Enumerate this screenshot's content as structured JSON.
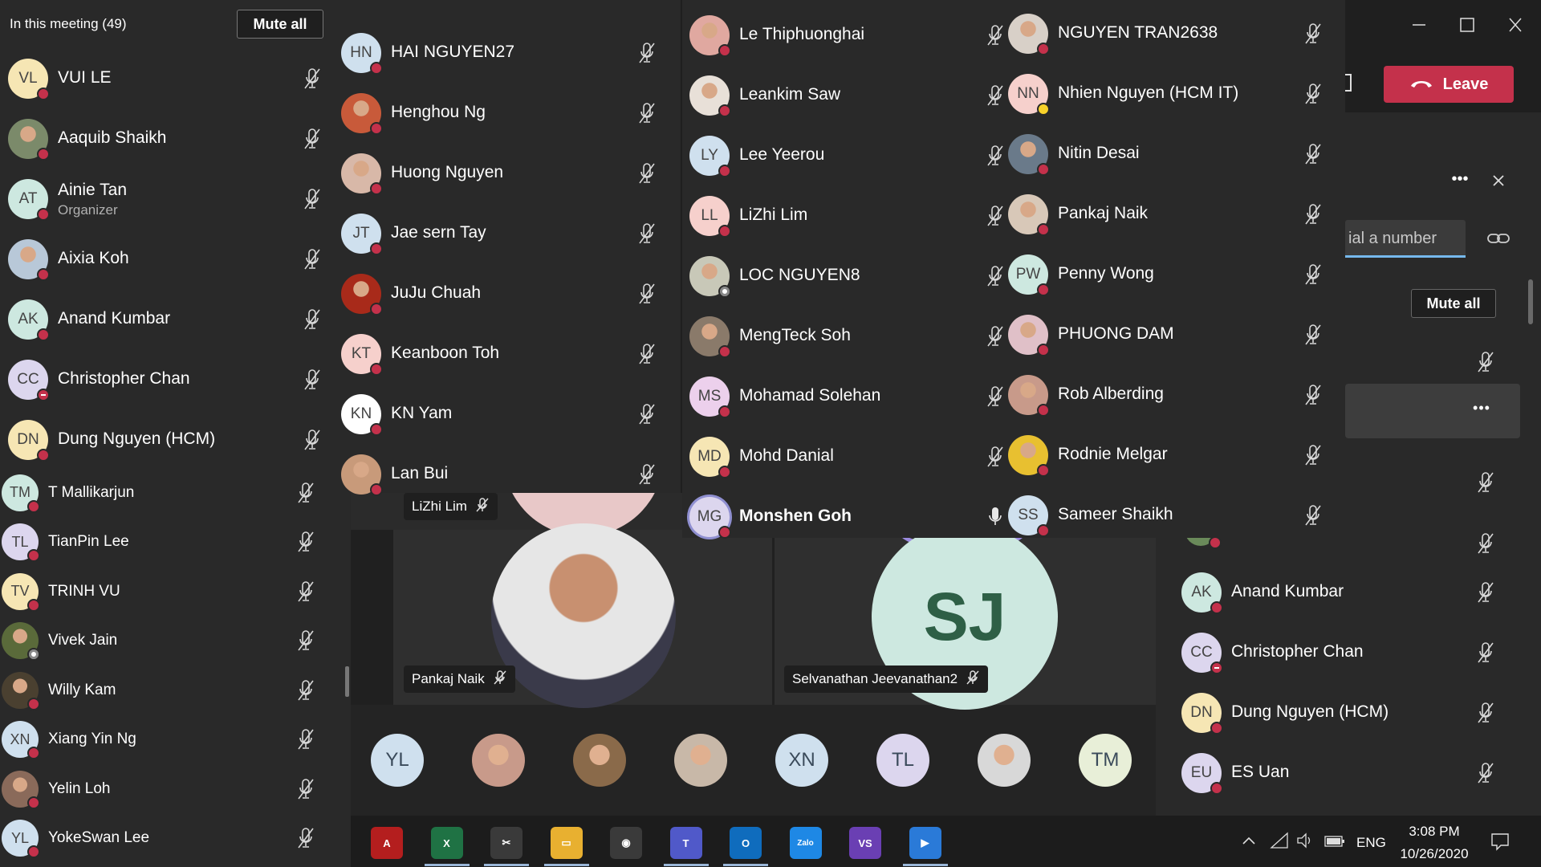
{
  "left_panel": {
    "header": "In this meeting (49)",
    "mute_all": "Mute all",
    "participants": [
      {
        "name": "VUI LE",
        "initials": "VL",
        "bg": "#f6e6b4",
        "status": "busy"
      },
      {
        "name": "Aaquib Shaikh",
        "initials": "",
        "bg": "#7b8a6a",
        "status": "busy",
        "photo": true
      },
      {
        "name": "Ainie Tan",
        "subtitle": "Organizer",
        "initials": "AT",
        "bg": "#cde8e0",
        "status": "busy"
      },
      {
        "name": "Aixia Koh",
        "initials": "",
        "bg": "#b8c8d8",
        "status": "busy",
        "photo": true
      },
      {
        "name": "Anand Kumbar",
        "initials": "AK",
        "bg": "#cde8e0",
        "status": "busy"
      },
      {
        "name": "Christopher Chan",
        "initials": "CC",
        "bg": "#dcd6ee",
        "status": "dnd"
      },
      {
        "name": "Dung Nguyen (HCM)",
        "initials": "DN",
        "bg": "#f6e6b4",
        "status": "busy"
      },
      {
        "name": "T Mallikarjun",
        "initials": "TM",
        "bg": "#cde8e0",
        "status": "busy"
      },
      {
        "name": "TianPin Lee",
        "initials": "TL",
        "bg": "#dcd6ee",
        "status": "busy"
      },
      {
        "name": "TRINH VU",
        "initials": "TV",
        "bg": "#f6e6b4",
        "status": "busy"
      },
      {
        "name": "Vivek Jain",
        "initials": "",
        "bg": "#5a6a3a",
        "status": "offline",
        "photo": true
      },
      {
        "name": "Willy Kam",
        "initials": "",
        "bg": "#4a4030",
        "status": "busy",
        "photo": true
      },
      {
        "name": "Xiang Yin Ng",
        "initials": "XN",
        "bg": "#cfe0ee",
        "status": "busy"
      },
      {
        "name": "Yelin Loh",
        "initials": "",
        "bg": "#8a6a5a",
        "status": "busy",
        "photo": true
      },
      {
        "name": "YokeSwan Lee",
        "initials": "YL",
        "bg": "#cfe0ee",
        "status": "busy"
      }
    ]
  },
  "col2": [
    {
      "name": "HAI NGUYEN27",
      "initials": "HN",
      "bg": "#cfe0ee",
      "status": "busy"
    },
    {
      "name": "Henghou Ng",
      "initials": "",
      "bg": "#c85a3a",
      "status": "busy",
      "photo": true
    },
    {
      "name": "Huong Nguyen",
      "initials": "",
      "bg": "#d8b8a8",
      "status": "busy",
      "photo": true
    },
    {
      "name": "Jae sern Tay",
      "initials": "JT",
      "bg": "#cfe0ee",
      "status": "busy"
    },
    {
      "name": "JuJu Chuah",
      "initials": "",
      "bg": "#a82a1a",
      "status": "busy",
      "photo": true
    },
    {
      "name": "Keanboon Toh",
      "initials": "KT",
      "bg": "#f6d0cc",
      "status": "busy"
    },
    {
      "name": "KN Yam",
      "initials": "KN",
      "bg": "#ffffff",
      "status": "busy"
    },
    {
      "name": "Lan Bui",
      "initials": "",
      "bg": "#c89a7a",
      "status": "busy",
      "photo": true
    }
  ],
  "col3": [
    {
      "name": "Le Thiphuonghai",
      "initials": "",
      "bg": "#e0a8a0",
      "status": "busy",
      "photo": true
    },
    {
      "name": "Leankim Saw",
      "initials": "",
      "bg": "#e8e0d8",
      "status": "busy",
      "photo": true
    },
    {
      "name": "Lee Yeerou",
      "initials": "LY",
      "bg": "#cfe0ee",
      "status": "busy"
    },
    {
      "name": "LiZhi Lim",
      "initials": "LL",
      "bg": "#f6d0cc",
      "status": "busy"
    },
    {
      "name": "LOC NGUYEN8",
      "initials": "",
      "bg": "#c8c8b8",
      "status": "offline",
      "photo": true
    },
    {
      "name": "MengTeck Soh",
      "initials": "",
      "bg": "#8a7a6a",
      "status": "busy",
      "photo": true
    },
    {
      "name": "Mohamad Solehan",
      "initials": "MS",
      "bg": "#ecd0ec",
      "status": "busy"
    },
    {
      "name": "Mohd Danial",
      "initials": "MD",
      "bg": "#f6e6b4",
      "status": "busy"
    },
    {
      "name": "Monshen Goh",
      "initials": "MG",
      "bg": "#dcd6ee",
      "status": "busy",
      "bold": true,
      "unmuted": true
    }
  ],
  "col4": [
    {
      "name": "NGUYEN TRAN2638",
      "initials": "",
      "bg": "#d8d0c8",
      "status": "busy",
      "photo": true
    },
    {
      "name": "Nhien Nguyen (HCM IT)",
      "initials": "NN",
      "bg": "#f6d0cc",
      "status": "away"
    },
    {
      "name": "Nitin Desai",
      "initials": "",
      "bg": "#6a7a8a",
      "status": "busy",
      "photo": true
    },
    {
      "name": "Pankaj Naik",
      "initials": "",
      "bg": "#d8c8b8",
      "status": "busy",
      "photo": true
    },
    {
      "name": "Penny Wong",
      "initials": "PW",
      "bg": "#cde8e0",
      "status": "busy"
    },
    {
      "name": "PHUONG DAM",
      "initials": "",
      "bg": "#e0c0c8",
      "status": "busy",
      "photo": true
    },
    {
      "name": "Rob Alberding",
      "initials": "",
      "bg": "#c89a8a",
      "status": "busy",
      "photo": true
    },
    {
      "name": "Rodnie Melgar",
      "initials": "",
      "bg": "#e8c030",
      "status": "busy",
      "photo": true
    },
    {
      "name": "Sameer Shaikh",
      "initials": "SS",
      "bg": "#cfe0ee",
      "status": "busy"
    }
  ],
  "video": {
    "tile1_label": "LiZhi Lim",
    "tile2_label": "Pankaj Naik",
    "tile3_label": "Selvanathan Jeevanathan2",
    "tile3_initials": "SJ"
  },
  "bottom_strip": [
    {
      "initials": "YL",
      "bg": "#cfe0ee"
    },
    {
      "initials": "",
      "bg": "#c89a8a",
      "photo": true
    },
    {
      "initials": "",
      "bg": "#8a6a4a",
      "photo": true
    },
    {
      "initials": "",
      "bg": "#c8b8a8",
      "photo": true
    },
    {
      "initials": "XN",
      "bg": "#cfe0ee"
    },
    {
      "initials": "TL",
      "bg": "#dcd6ee"
    },
    {
      "initials": "",
      "bg": "#d8d8d8",
      "photo": true
    },
    {
      "initials": "TM",
      "bg": "#e8efd8"
    }
  ],
  "right_panel": {
    "leave_label": "Leave",
    "more_label": "•••",
    "dial_placeholder": "ial a number",
    "mute_all": "Mute all",
    "participants": [
      {
        "name": "Anand Kumbar",
        "initials": "AK",
        "bg": "#cde8e0",
        "status": "busy"
      },
      {
        "name": "Christopher Chan",
        "initials": "CC",
        "bg": "#dcd6ee",
        "status": "dnd"
      },
      {
        "name": "Dung Nguyen (HCM)",
        "initials": "DN",
        "bg": "#f6e6b4",
        "status": "busy"
      },
      {
        "name": "ES Uan",
        "initials": "EU",
        "bg": "#dcd6ee",
        "status": "busy"
      }
    ]
  },
  "taskbar": {
    "icons": [
      {
        "name": "acrobat-icon",
        "bg": "#b41e1e",
        "glyph": "A"
      },
      {
        "name": "excel-icon",
        "bg": "#1f7244",
        "glyph": "X"
      },
      {
        "name": "snip-icon",
        "bg": "#3a3a3a",
        "glyph": "✂"
      },
      {
        "name": "explorer-icon",
        "bg": "#e8b030",
        "glyph": "▭"
      },
      {
        "name": "chrome-icon",
        "bg": "#3a3a3a",
        "glyph": "◉"
      },
      {
        "name": "teams-icon",
        "bg": "#5059c9",
        "glyph": "T"
      },
      {
        "name": "outlook-icon",
        "bg": "#0f6cbd",
        "glyph": "O"
      },
      {
        "name": "zalo-icon",
        "bg": "#1e88e5",
        "glyph": "Zalo"
      },
      {
        "name": "visual-studio-icon",
        "bg": "#6a3fb3",
        "glyph": "VS"
      },
      {
        "name": "player-icon",
        "bg": "#2a7ad8",
        "glyph": "▶"
      }
    ],
    "lang": "ENG",
    "time": "3:08 PM",
    "date": "10/26/2020"
  },
  "colors": {
    "panel_bg": "#292929",
    "stage_bg": "#1f1f1f",
    "leave_red": "#c4314b",
    "busy_red": "#c4314b"
  }
}
